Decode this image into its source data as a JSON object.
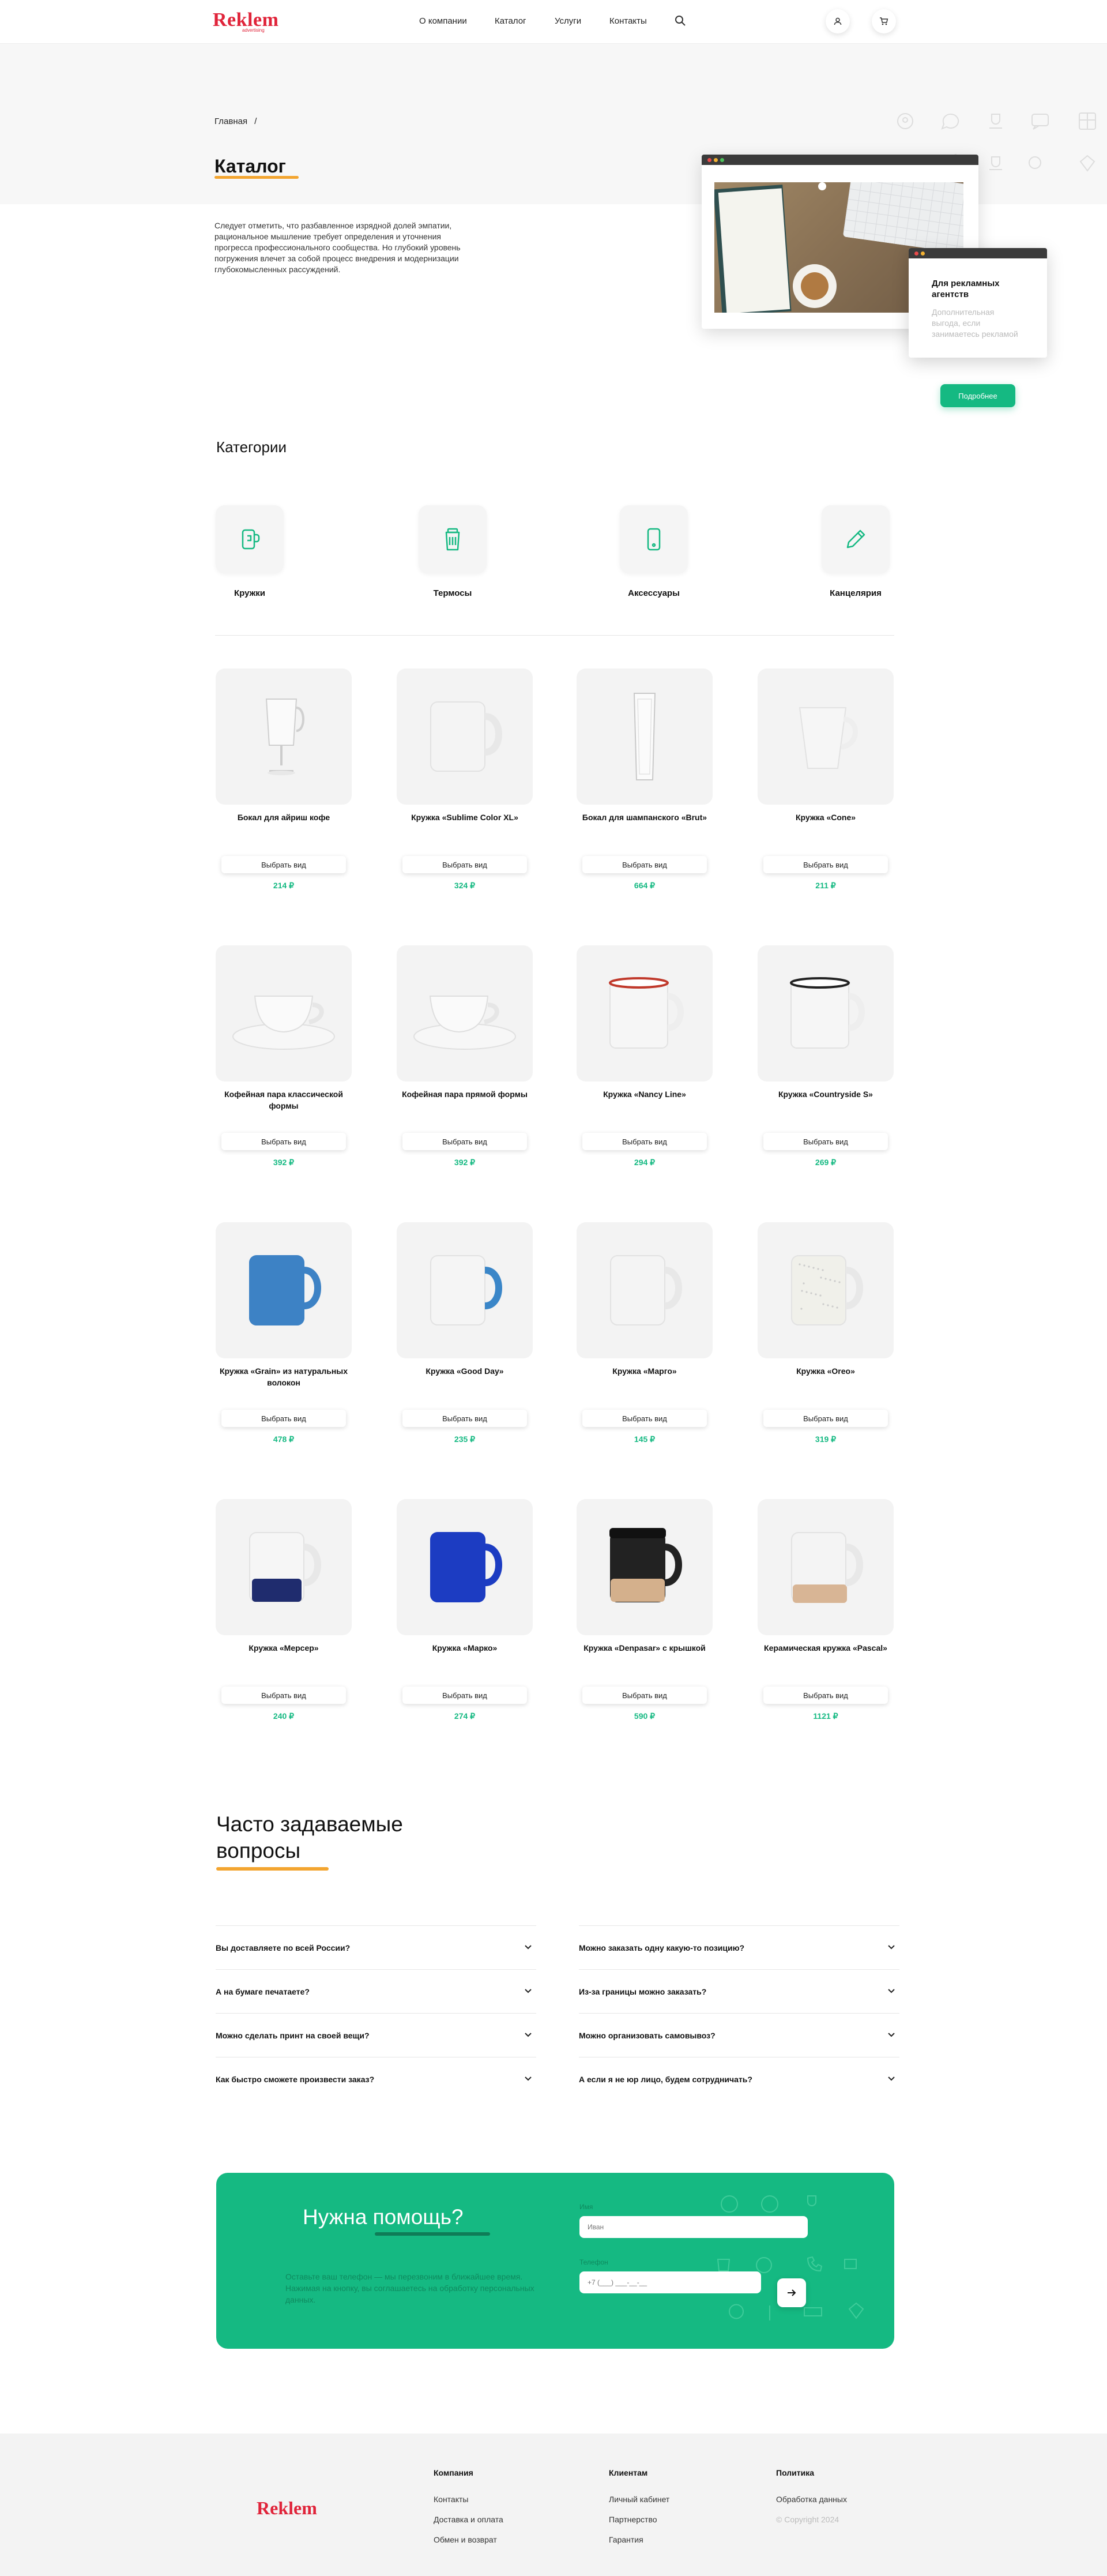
{
  "header": {
    "logo": "Reklem",
    "logo_sub": "advertising",
    "nav": [
      "О компании",
      "Каталог",
      "Услуги",
      "Контакты"
    ]
  },
  "hero": {
    "breadcrumb_home": "Главная",
    "breadcrumb_sep": "/",
    "title": "Каталог",
    "description": "Следует отметить, что разбавленное изрядной долей эмпатии, рациональное мышление требует определения и уточнения прогресса профессионального сообщества. Но глубокий уровень погружения влечет за собой процесс внедрения и модернизации глубокомысленных рассуждений.",
    "popup_title": "Для рекламных агентств",
    "popup_text": "Дополнительная выгода, если занимаетесь рекламой",
    "button": "Подробнее"
  },
  "categories": {
    "title": "Категории",
    "items": [
      {
        "label": "Кружки",
        "icon": "mug-icon"
      },
      {
        "label": "Термосы",
        "icon": "thermos-icon"
      },
      {
        "label": "Аксессуары",
        "icon": "phone-icon"
      },
      {
        "label": "Канцелярия",
        "icon": "pencil-icon"
      }
    ]
  },
  "products": {
    "button_label": "Выбрать вид",
    "items": [
      {
        "name": "Бокал для айриш кофе",
        "price": "214 ₽",
        "kind": "irish"
      },
      {
        "name": "Кружка «Sublime Color XL»",
        "price": "324 ₽",
        "kind": "mug-white"
      },
      {
        "name": "Бокал для шампанского «Brut»",
        "price": "664 ₽",
        "kind": "flute"
      },
      {
        "name": "Кружка «Cone»",
        "price": "211 ₽",
        "kind": "cone"
      },
      {
        "name": "Кофейная пара классической формы",
        "price": "392 ₽",
        "kind": "cup-saucer"
      },
      {
        "name": "Кофейная пара прямой формы",
        "price": "392 ₽",
        "kind": "cup-saucer2"
      },
      {
        "name": "Кружка «Nancy Line»",
        "price": "294 ₽",
        "kind": "enamel-red"
      },
      {
        "name": "Кружка «Countryside S»",
        "price": "269 ₽",
        "kind": "enamel-black"
      },
      {
        "name": "Кружка «Grain» из натуральных волокон",
        "price": "478 ₽",
        "kind": "mug-blue"
      },
      {
        "name": "Кружка «Good Day»",
        "price": "235 ₽",
        "kind": "mug-white-bluehandle"
      },
      {
        "name": "Кружка «Марго»",
        "price": "145 ₽",
        "kind": "mug-white"
      },
      {
        "name": "Кружка «Oreo»",
        "price": "319 ₽",
        "kind": "mug-speckled"
      },
      {
        "name": "Кружка «Мерсер»",
        "price": "240 ₽",
        "kind": "mug-navy-bottom"
      },
      {
        "name": "Кружка «Марко»",
        "price": "274 ₽",
        "kind": "mug-royal"
      },
      {
        "name": "Кружка «Denpasar» с крышкой",
        "price": "590 ₽",
        "kind": "mug-lid"
      },
      {
        "name": "Керамическая кружка «Pascal»",
        "price": "1121 ₽",
        "kind": "mug-cork"
      }
    ]
  },
  "faq": {
    "title": "Часто задаваемые вопросы",
    "left": [
      "Вы доставляете по всей России?",
      "А на бумаге печатаете?",
      "Можно сделать принт на своей вещи?",
      "Как быстро сможете произвести заказ?"
    ],
    "right": [
      "Можно заказать одну какую-то позицию?",
      "Из-за границы можно заказать?",
      "Можно организовать самовывоз?",
      "А если я не юр лицо, будем сотрудничать?"
    ]
  },
  "help": {
    "title": "Нужна помощь?",
    "text": "Оставьте ваш телефон — мы перезвоним в ближайшее время. Нажимая на кнопку, вы соглашаетесь на обработку персональных данных.",
    "name_label": "Имя",
    "name_placeholder": "Иван",
    "phone_label": "Телефон",
    "phone_placeholder": "+7 (___) ___-__-__"
  },
  "footer": {
    "logo": "Reklem",
    "col1_title": "Компания",
    "col1": [
      "Контакты",
      "Доставка и оплата",
      "Обмен и возврат"
    ],
    "col2_title": "Клиентам",
    "col2": [
      "Личный кабинет",
      "Партнерство",
      "Гарантия"
    ],
    "col3_title": "Политика",
    "col3_link": "Обработка данных",
    "copyright": "© Copyright 2024"
  },
  "colors": {
    "brand_red": "#e0243a",
    "accent_green": "#15b982",
    "accent_orange": "#f3a530"
  }
}
